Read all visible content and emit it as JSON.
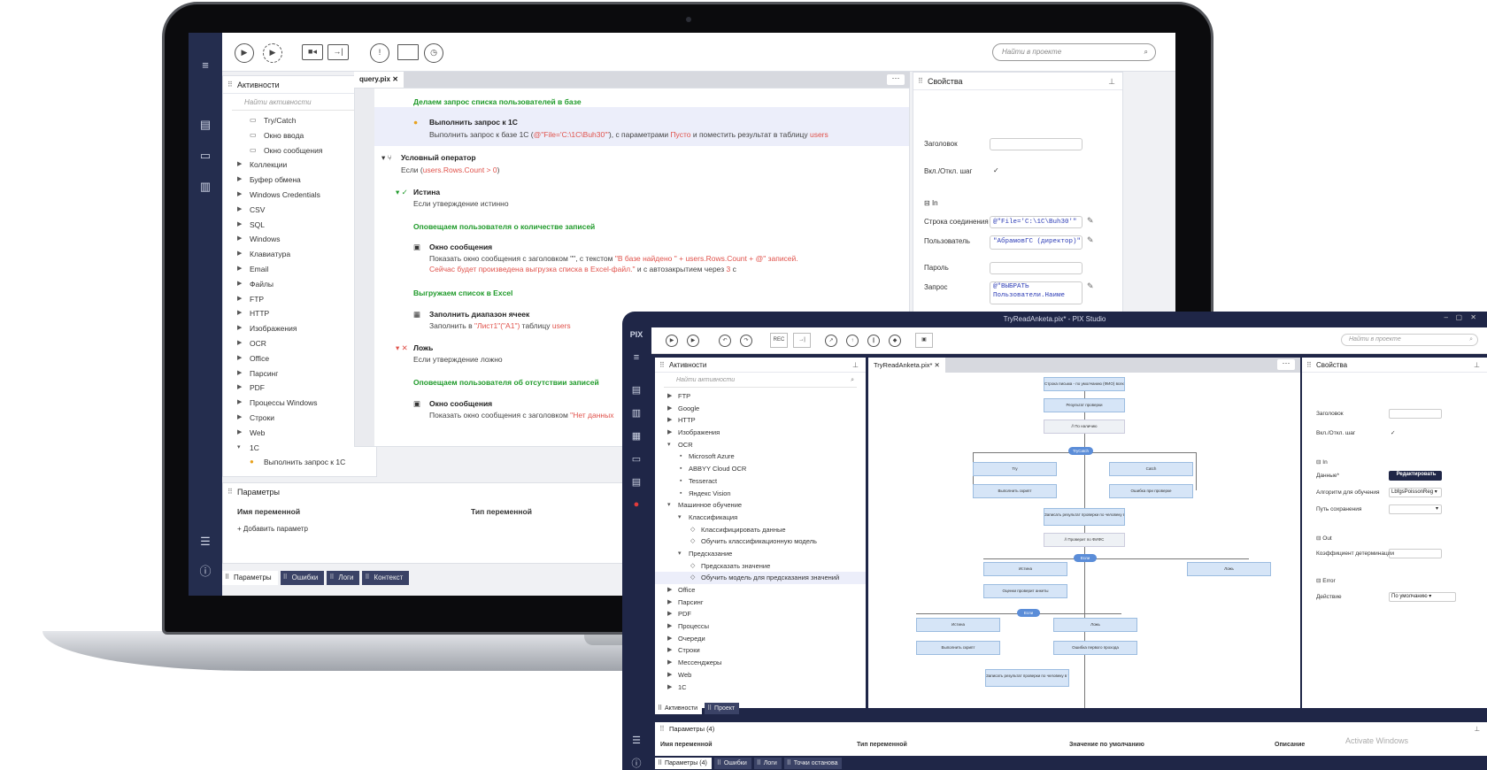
{
  "laptop": {
    "search_placeholder": "Найти в проекте",
    "activities": {
      "title": "Активности",
      "search_placeholder": "Найти активности",
      "items": [
        {
          "label": "Try/Catch",
          "icon": "try-icon",
          "level": 1
        },
        {
          "label": "Окно ввода",
          "icon": "input-icon",
          "level": 1
        },
        {
          "label": "Окно сообщения",
          "icon": "message-icon",
          "level": 1
        },
        {
          "label": "Коллекции",
          "level": 0
        },
        {
          "label": "Буфер обмена",
          "level": 0
        },
        {
          "label": "Windows Credentials",
          "level": 0
        },
        {
          "label": "CSV",
          "level": 0
        },
        {
          "label": "SQL",
          "level": 0
        },
        {
          "label": "Windows",
          "level": 0
        },
        {
          "label": "Клавиатура",
          "level": 0
        },
        {
          "label": "Email",
          "level": 0
        },
        {
          "label": "Файлы",
          "level": 0
        },
        {
          "label": "FTP",
          "level": 0
        },
        {
          "label": "HTTP",
          "level": 0
        },
        {
          "label": "Изображения",
          "level": 0
        },
        {
          "label": "OCR",
          "level": 0
        },
        {
          "label": "Office",
          "level": 0
        },
        {
          "label": "Парсинг",
          "level": 0
        },
        {
          "label": "PDF",
          "level": 0
        },
        {
          "label": "Процессы Windows",
          "level": 0
        },
        {
          "label": "Строки",
          "level": 0
        },
        {
          "label": "Web",
          "level": 0
        },
        {
          "label": "1С",
          "level": 0,
          "open": true
        },
        {
          "label": "Выполнить запрос к 1С",
          "icon": "1c-icon",
          "level": 1
        }
      ]
    },
    "tab": "query.pix",
    "workflow": {
      "comment1": "Делаем запрос списка пользователей в базе",
      "step1_title": "Выполнить запрос к 1С",
      "step1_desc_a": "Выполнить запрос к базе 1С (",
      "step1_desc_b": "@\"File='C:\\1C\\Buh30'\"",
      "step1_desc_c": "), с параметрами ",
      "step1_desc_d": "Пусто",
      "step1_desc_e": " и поместить результат в таблицу ",
      "step1_desc_f": "users",
      "cond_title": "Условный оператор",
      "cond_desc_a": "Если (",
      "cond_desc_b": "users.Rows.Count > 0",
      "cond_desc_c": ")",
      "true_title": "Истина",
      "true_desc": "Если утверждение истинно",
      "comment2": "Оповещаем пользователя о количестве записей",
      "msg_title": "Окно сообщения",
      "msg_desc_a": "Показать окно сообщения с заголовком \"\", с текстом ",
      "msg_desc_b": "\"В базе найдено \" + users.Rows.Count + @\" записей.",
      "msg_desc_c": "Сейчас будет произведена выгрузка списка в Excel-файл.\"",
      "msg_desc_d": " и с автозакрытием через ",
      "msg_desc_e": "3",
      "msg_desc_f": " с",
      "comment3": "Выгружаем список в Excel",
      "fill_title": "Заполнить диапазон ячеек",
      "fill_desc_a": "Заполнить в ",
      "fill_desc_b": "\"Лист1\"(\"A1\")",
      "fill_desc_c": " таблицу ",
      "fill_desc_d": "users",
      "false_title": "Ложь",
      "false_desc": "Если утверждение ложно",
      "comment4": "Оповещаем пользователя об отсутствии записей",
      "msg2_title": "Окно сообщения",
      "msg2_desc_a": "Показать окно сообщения с заголовком ",
      "msg2_desc_b": "\"Нет данных"
    },
    "properties": {
      "title": "Свойства",
      "header_label": "Заголовок",
      "toggle_label": "Вкл./Откл. шаг",
      "in_label": "In",
      "conn_label": "Строка соединения",
      "conn_value": "@\"File='C:\\1C\\Buh30'\"",
      "user_label": "Пользователь",
      "user_value": "\"АбрамовГС (директор)\"",
      "pass_label": "Пароль",
      "query_label": "Запрос",
      "query_value_1": "@\"ВЫБРАТЬ",
      "query_value_2": "   Пользователи.Наиме"
    },
    "params": {
      "title": "Параметры",
      "col_name": "Имя переменной",
      "col_type": "Тип переменной",
      "add": "+ Добавить параметр"
    },
    "bottom_tabs": [
      "Параметры",
      "Ошибки",
      "Логи",
      "Контекст"
    ]
  },
  "studio": {
    "title": "TryReadAnketa.pix* - PIX Studio",
    "logo": "PIX",
    "search_placeholder": "Найти в проекте",
    "rec_label": "REC",
    "activities": {
      "title": "Активности",
      "search_placeholder": "Найти активности",
      "items": [
        {
          "label": "FTP",
          "level": 0
        },
        {
          "label": "Google",
          "level": 0
        },
        {
          "label": "HTTP",
          "level": 0
        },
        {
          "label": "Изображения",
          "level": 0
        },
        {
          "label": "OCR",
          "level": 0,
          "open": true
        },
        {
          "label": "Microsoft Azure",
          "level": 1
        },
        {
          "label": "ABBYY Cloud OCR",
          "level": 1
        },
        {
          "label": "Tesseract",
          "level": 1
        },
        {
          "label": "Яндекс Vision",
          "level": 1
        },
        {
          "label": "Машинное обучение",
          "level": 0,
          "open": true
        },
        {
          "label": "Классификация",
          "level": 1,
          "open": true
        },
        {
          "label": "Классифицировать данные",
          "level": 2
        },
        {
          "label": "Обучить классификационную модель",
          "level": 2
        },
        {
          "label": "Предсказание",
          "level": 1,
          "open": true
        },
        {
          "label": "Предсказать значение",
          "level": 2
        },
        {
          "label": "Обучить модель для предсказания значений",
          "level": 2
        },
        {
          "label": "Office",
          "level": 0
        },
        {
          "label": "Парсинг",
          "level": 0
        },
        {
          "label": "PDF",
          "level": 0
        },
        {
          "label": "Процессы",
          "level": 0
        },
        {
          "label": "Очереди",
          "level": 0
        },
        {
          "label": "Строки",
          "level": 0
        },
        {
          "label": "Мессенджеры",
          "level": 0
        },
        {
          "label": "Web",
          "level": 0
        },
        {
          "label": "1С",
          "level": 0
        }
      ],
      "tabs": [
        "Активности",
        "Проект"
      ]
    },
    "tab": "TryReadAnketa.pix*",
    "flow": {
      "n1": "Строка письма - по умолчанию (ФИО) всех опечатки по ФИО)",
      "n2": "Результат проверки",
      "n3": "// По наличию",
      "p1": "TryCatch",
      "try": "Try",
      "catch": "Catch",
      "n4": "Выполнить скрипт",
      "n5": "Ошибка при проверке",
      "n6": "Записать результат проверки по человеку в таблицу (текущий Dictionary)",
      "n7": "// Проверит по ФИФС",
      "p2": "Если",
      "true1": "Истина",
      "false1": "Ложь",
      "n8": "Оценки проверит анкеты",
      "p3": "Если",
      "true2": "Истина",
      "false2": "Ложь",
      "n9": "Выполнить скрипт",
      "n10": "Ошибка первого прохода",
      "n11": "Записать результат проверки по человеку в таблицу (текущий Dictionary)"
    },
    "properties": {
      "title": "Свойства",
      "header_label": "Заголовок",
      "toggle_label": "Вкл./Откл. шаг",
      "in_label": "In",
      "data_label": "Данные*",
      "edit_button": "Редактировать",
      "algo_label": "Алгоритм для обучения",
      "algo_value": "LbfgsPoissonReg",
      "save_label": "Путь сохранения",
      "out_label": "Out",
      "coef_label": "Коэффициент детерминации",
      "error_label": "Error",
      "action_label": "Действие",
      "action_value": "По умолчанию"
    },
    "params": {
      "title": "Параметры (4)",
      "col_name": "Имя переменной",
      "col_type": "Тип переменной",
      "col_default": "Значение по умолчанию",
      "col_desc": "Описание"
    },
    "watermark": "Activate Windows",
    "bottom_tabs": [
      "Параметры (4)",
      "Ошибки",
      "Логи",
      "Точки останова"
    ]
  }
}
